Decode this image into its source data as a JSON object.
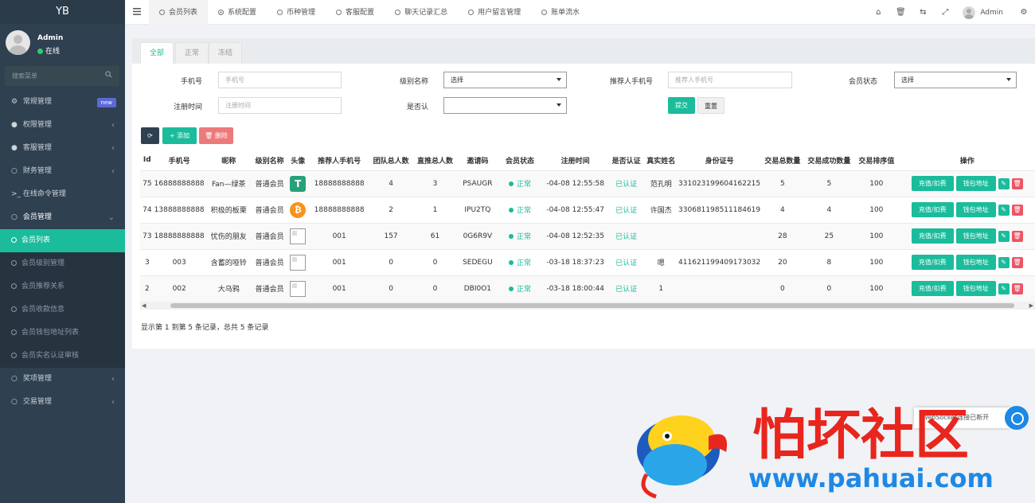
{
  "sidebar": {
    "brand": "YB",
    "user": {
      "name": "Admin",
      "status": "在线"
    },
    "search_placeholder": "搜索菜单",
    "menu": [
      {
        "label": "常规管理",
        "icon": "gears-icon",
        "badge": "new"
      },
      {
        "label": "权限管理",
        "icon": "users-icon"
      },
      {
        "label": "客服管理",
        "icon": "comment-icon"
      },
      {
        "label": "财务管理",
        "icon": "circle-icon"
      },
      {
        "label": "在线命令管理",
        "icon": "terminal-icon"
      },
      {
        "label": "会员管理",
        "icon": "circle-icon"
      },
      {
        "label": "奖项管理",
        "icon": "circle-icon"
      },
      {
        "label": "交易管理",
        "icon": "circle-icon"
      }
    ],
    "member_sub": [
      "会员列表",
      "会员级别管理",
      "会员推荐关系",
      "会员收款信息",
      "会员钱包地址列表",
      "会员实名认证审核"
    ]
  },
  "topbar": {
    "tabs": [
      "会员列表",
      "系统配置",
      "币种管理",
      "客服配置",
      "聊天记录汇总",
      "用户留言管理",
      "账单流水"
    ],
    "user": "Admin"
  },
  "filter": {
    "subtabs": [
      "全部",
      "正常",
      "冻结"
    ],
    "phone_label": "手机号",
    "phone_placeholder": "手机号",
    "level_label": "级别名称",
    "level_value": "选择",
    "referrer_label": "推荐人手机号",
    "referrer_placeholder": "推荐人手机号",
    "status_label": "会员状态",
    "status_value": "选择",
    "regtime_label": "注册时间",
    "regtime_placeholder": "注册时间",
    "verified_label": "是否认",
    "submit": "提交",
    "reset": "重置"
  },
  "toolbar": {
    "add": "添加",
    "delete": "删除"
  },
  "table": {
    "headers": [
      "Id",
      "手机号",
      "昵称",
      "级别名称",
      "头像",
      "推荐人手机号",
      "团队总人数",
      "直推总人数",
      "邀请码",
      "会员状态",
      "注册时间",
      "是否认证",
      "真实姓名",
      "身份证号",
      "交易总数量",
      "交易成功数量",
      "交易排序值",
      "操作"
    ],
    "rows": [
      {
        "id": "75",
        "phone": "16888888888",
        "nick": "Fan—绿茶",
        "level": "普通会员",
        "avatar": "tether",
        "ref": "18888888888",
        "team": "4",
        "direct": "3",
        "code": "PSAUGR",
        "status": "正常",
        "time": "-04-08 12:55:58",
        "verified": "已认证",
        "name": "范孔明",
        "idno": "331023199604162215",
        "total": "5",
        "success": "5",
        "sort": "100"
      },
      {
        "id": "74",
        "phone": "13888888888",
        "nick": "积极的板栗",
        "level": "普通会员",
        "avatar": "btc",
        "ref": "18888888888",
        "team": "2",
        "direct": "1",
        "code": "IPU2TQ",
        "status": "正常",
        "time": "-04-08 12:55:47",
        "verified": "已认证",
        "name": "许国杰",
        "idno": "330681198511184619",
        "total": "4",
        "success": "4",
        "sort": "100"
      },
      {
        "id": "73",
        "phone": "18888888888",
        "nick": "忧伤的朋友",
        "level": "普通会员",
        "avatar": "broken",
        "ref": "001",
        "team": "157",
        "direct": "61",
        "code": "0G6R9V",
        "status": "正常",
        "time": "-04-08 12:52:35",
        "verified": "已认证",
        "name": "",
        "idno": "",
        "total": "28",
        "success": "25",
        "sort": "100"
      },
      {
        "id": "3",
        "phone": "003",
        "nick": "含蓄的哑铃",
        "level": "普通会员",
        "avatar": "broken",
        "ref": "001",
        "team": "0",
        "direct": "0",
        "code": "SEDEGU",
        "status": "正常",
        "time": "-03-18 18:37:23",
        "verified": "已认证",
        "name": "嗯",
        "idno": "411621199409173032",
        "total": "20",
        "success": "8",
        "sort": "100"
      },
      {
        "id": "2",
        "phone": "002",
        "nick": "大乌鸦",
        "level": "普通会员",
        "avatar": "broken",
        "ref": "001",
        "team": "0",
        "direct": "0",
        "code": "DBI0O1",
        "status": "正常",
        "time": "-03-18 18:00:44",
        "verified": "已认证",
        "name": "1",
        "idno": "",
        "total": "0",
        "success": "0",
        "sort": "100"
      }
    ],
    "op_recharge": "充值/扣费",
    "op_wallet": "钱包地址"
  },
  "pagination": {
    "info": "显示第 1 到第 5 条记录，总共 5 条记录"
  },
  "toast": "WebSocket连接已断开",
  "watermark": {
    "title": "怕坏社区",
    "url": "www.pahuai.com"
  },
  "colors": {
    "accent": "#1abc9c",
    "sidebar": "#2f4050",
    "danger": "#ed5565"
  }
}
